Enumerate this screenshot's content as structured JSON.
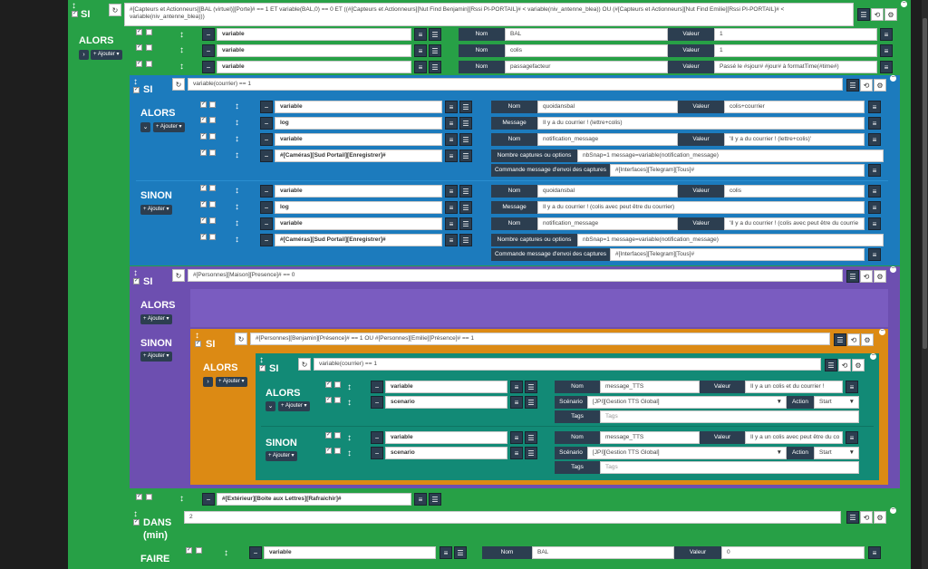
{
  "keywords": {
    "si": "SI",
    "alors": "ALORS",
    "sinon": "SINON",
    "dans": "DANS",
    "min": "(min)",
    "faire": "FAIRE",
    "add": "Ajouter"
  },
  "colors": {
    "green": "#27a046",
    "blue": "#1c7bbd",
    "purple": "#6d4fb0",
    "orange": "#dc8a14",
    "teal": "#128a76",
    "dark": "#2c3e50"
  },
  "icons": {
    "refresh": "↻",
    "edit": "☰",
    "history": "⟲",
    "settings": "⚙",
    "minus": "−",
    "list": "≡",
    "drag": "↕",
    "check": "✓",
    "chevron": "›",
    "chevron_down": "⌄",
    "plus": "+"
  },
  "si1": {
    "condition": "#[Capteurs et Actionneurs][BAL (virtuel)][Porte]# == 1  ET variable(BAL,0) == 0 ET ((#[Capteurs et Actionneurs][Nut Find Benjamin][Rssi PI-PORTAIL]# < variable(niv_antenne_blea)) OU (#[Capteurs et Actionneurs][Nut Find Emilie][Rssi PI-PORTAIL]# < variable(niv_antenne_blea)))"
  },
  "alors1_actions": [
    {
      "type": "variable",
      "nom_label": "Nom",
      "nom": "BAL",
      "val_label": "Valeur",
      "valeur": "1"
    },
    {
      "type": "variable",
      "nom_label": "Nom",
      "nom": "colis",
      "val_label": "Valeur",
      "valeur": "1"
    },
    {
      "type": "variable",
      "nom_label": "Nom",
      "nom": "passagefacteur",
      "val_label": "Valeur",
      "valeur": "Passé le #sjour# #jour# à formatTime(#time#)"
    }
  ],
  "si2": {
    "condition": "variable(courrier) == 1"
  },
  "alors2": {
    "a1": {
      "type": "variable",
      "nom_label": "Nom",
      "nom": "quoidansbal",
      "val_label": "Valeur",
      "valeur": "colis+courrier"
    },
    "a2": {
      "type": "log",
      "msg_label": "Message",
      "message": "Il y a du courrier ! (lettre+colis)"
    },
    "a3": {
      "type": "variable",
      "nom_label": "Nom",
      "nom": "notification_message",
      "val_label": "Valeur",
      "valeur": "'Il y a du courrier ! (lettre+colis)'"
    },
    "a4": {
      "type": "#[Caméras][Sud Portail][Enregistrer]#",
      "opt_label": "Nombre captures ou options",
      "options": "nbSnap=1 message=variable(notification_message)",
      "cmd_label": "Commande message d'envoi des captures",
      "commande": "#[Interfaces][Telegram][Tous]#"
    }
  },
  "sinon2": {
    "a1": {
      "type": "variable",
      "nom_label": "Nom",
      "nom": "quoidansbal",
      "val_label": "Valeur",
      "valeur": "colis"
    },
    "a2": {
      "type": "log",
      "msg_label": "Message",
      "message": "Il y a du courrier ! (colis avec peut être du courrier)"
    },
    "a3": {
      "type": "variable",
      "nom_label": "Nom",
      "nom": "notification_message",
      "val_label": "Valeur",
      "valeur": "'Il y a du courrier ! (colis avec peut être du courrie"
    },
    "a4": {
      "type": "#[Caméras][Sud Portail][Enregistrer]#",
      "opt_label": "Nombre captures ou options",
      "options": "nbSnap=1 message=variable(notification_message)",
      "cmd_label": "Commande message d'envoi des captures",
      "commande": "#[Interfaces][Telegram][Tous]#"
    }
  },
  "si3": {
    "condition": "#[Personnes][Maison][Presence]# == 0"
  },
  "si4": {
    "condition": "#[Personnes][Benjamin][Présence]# == 1  OU #[Personnes][Emilie][Présence]# == 1"
  },
  "si5": {
    "condition": "variable(courrier) == 1"
  },
  "alors5": {
    "a1": {
      "type": "variable",
      "nom_label": "Nom",
      "nom": "message_TTS",
      "val_label": "Valeur",
      "valeur": "Il y a un colis et du courrier !"
    },
    "a2": {
      "type": "scenario",
      "scen_label": "Scénario",
      "scenario": "[JPI][Gestion TTS Global]",
      "act_label": "Action",
      "action": "Start",
      "tags_label": "Tags",
      "tags_ph": "Tags"
    }
  },
  "sinon5": {
    "a1": {
      "type": "variable",
      "nom_label": "Nom",
      "nom": "message_TTS",
      "val_label": "Valeur",
      "valeur": "Il y a un colis avec peut être du co"
    },
    "a2": {
      "type": "scenario",
      "scen_label": "Scénario",
      "scenario": "[JPI][Gestion TTS Global]",
      "act_label": "Action",
      "action": "Start",
      "tags_label": "Tags",
      "tags_ph": "Tags"
    }
  },
  "refresh_action": {
    "type": "#[Extérieur][Boite aux Lettres][Rafraichir]#"
  },
  "dans": {
    "value": "2"
  },
  "faire_action": {
    "type": "variable",
    "nom_label": "Nom",
    "nom": "BAL",
    "val_label": "Valeur",
    "valeur": "0"
  }
}
